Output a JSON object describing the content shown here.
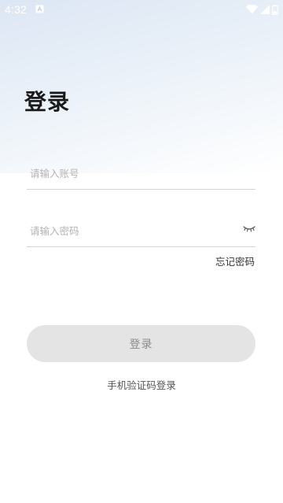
{
  "status_bar": {
    "time": "4:32",
    "icons": [
      "notification-a-icon",
      "wifi-icon",
      "cellular-signal-icon",
      "battery-icon"
    ]
  },
  "page": {
    "title": "登录"
  },
  "form": {
    "account": {
      "placeholder": "请输入账号",
      "value": ""
    },
    "password": {
      "placeholder": "请输入密码",
      "value": "",
      "visibility_icon": "eye-closed-icon"
    },
    "forgot_password_label": "忘记密码",
    "login_button_label": "登录",
    "sms_login_label": "手机验证码登录"
  },
  "colors": {
    "button_background": "#e4e4e4",
    "button_text": "#8a8a8a",
    "header_gradient_top": "#dce6f4"
  }
}
